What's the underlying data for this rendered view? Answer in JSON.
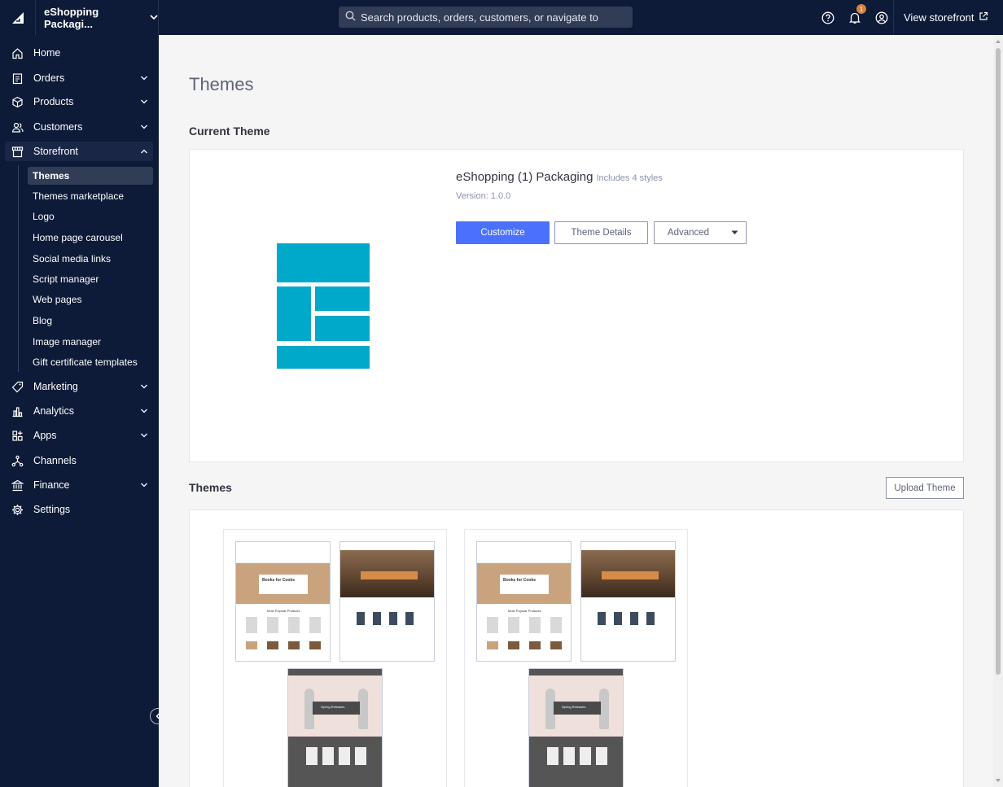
{
  "topbar": {
    "store_name": "eShopping Packagi...",
    "search_placeholder": "Search products, orders, customers, or navigate to",
    "notification_count": "1",
    "view_storefront": "View storefront"
  },
  "sidebar": {
    "items": [
      {
        "label": "Home",
        "icon": "home-icon"
      },
      {
        "label": "Orders",
        "icon": "orders-icon"
      },
      {
        "label": "Products",
        "icon": "products-icon"
      },
      {
        "label": "Customers",
        "icon": "customers-icon"
      },
      {
        "label": "Storefront",
        "icon": "storefront-icon"
      },
      {
        "label": "Marketing",
        "icon": "marketing-icon"
      },
      {
        "label": "Analytics",
        "icon": "analytics-icon"
      },
      {
        "label": "Apps",
        "icon": "apps-icon"
      },
      {
        "label": "Channels",
        "icon": "channels-icon"
      },
      {
        "label": "Finance",
        "icon": "finance-icon"
      },
      {
        "label": "Settings",
        "icon": "settings-icon"
      }
    ],
    "storefront_sub": [
      "Themes",
      "Themes marketplace",
      "Logo",
      "Home page carousel",
      "Social media links",
      "Script manager",
      "Web pages",
      "Blog",
      "Image manager",
      "Gift certificate templates"
    ]
  },
  "main": {
    "page_title": "Themes",
    "current_theme_heading": "Current Theme",
    "theme": {
      "name": "eShopping (1) Packaging",
      "styles": "Includes 4 styles",
      "version": "Version: 1.0.0",
      "customize": "Customize",
      "details": "Theme Details",
      "advanced": "Advanced"
    },
    "themes_heading": "Themes",
    "upload_theme": "Upload Theme",
    "thumb_text": {
      "cooks": "Books for Cooks",
      "popular": "Most Popular Products",
      "spring": "Spring Releases"
    }
  },
  "colors": {
    "nav_bg": "#0d1a38",
    "primary": "#4b71fc",
    "theme_logo": "#00a9c9",
    "badge": "#d97f3d"
  }
}
